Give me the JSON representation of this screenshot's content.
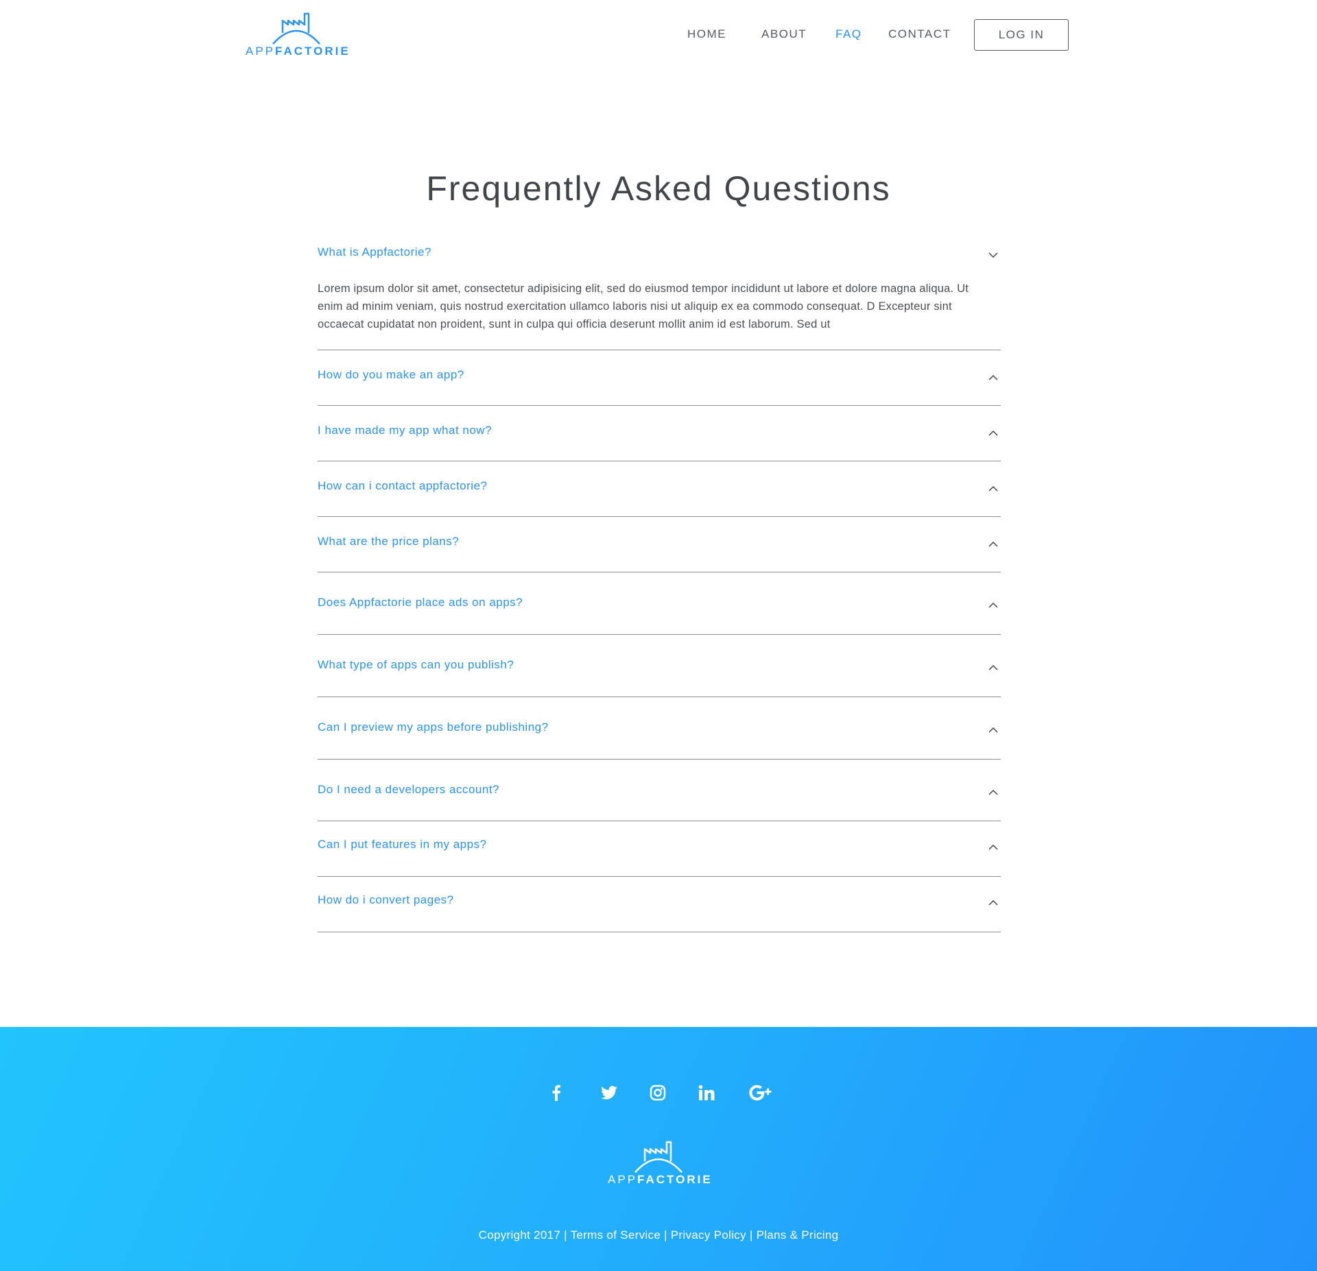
{
  "brand": {
    "app": "APP",
    "factorie": "FACTORIE",
    "accent_color": "#2a93ef"
  },
  "nav": {
    "home": "HOME",
    "about": "ABOUT",
    "faq": "FAQ",
    "contact": "CONTACT",
    "login": "LOG IN"
  },
  "faq": {
    "title": "Frequently Asked Questions",
    "items": [
      {
        "question": "What is Appfactorie?",
        "answer": "Lorem ipsum dolor sit amet, consectetur adipisicing elit, sed do eiusmod tempor incididunt ut labore et dolore magna aliqua. Ut enim ad minim veniam, quis nostrud exercitation ullamco laboris nisi ut aliquip ex ea commodo consequat. D Excepteur sint occaecat cupidatat non proident, sunt in culpa qui officia deserunt mollit anim id est laborum. Sed ut",
        "expanded": true
      },
      {
        "question": "How do you make an app?"
      },
      {
        "question": "I have made my app what now?"
      },
      {
        "question": "How can i contact appfactorie?"
      },
      {
        "question": "What are the price plans?"
      },
      {
        "question": "Does Appfactorie place ads on apps?"
      },
      {
        "question": "What type of apps can you publish?"
      },
      {
        "question": "Can I preview my apps before publishing?"
      },
      {
        "question": "Do I need a developers account?"
      },
      {
        "question": "Can I put features in my apps?"
      },
      {
        "question": "How do i convert pages?"
      }
    ]
  },
  "footer": {
    "social": [
      "facebook-icon",
      "twitter-icon",
      "instagram-icon",
      "linkedin-icon",
      "google-plus-icon"
    ],
    "copyright": "Copyright 2017",
    "separator": "|",
    "terms": "Terms of Service",
    "privacy": "Privacy Policy",
    "plans": "Plans & Pricing"
  }
}
